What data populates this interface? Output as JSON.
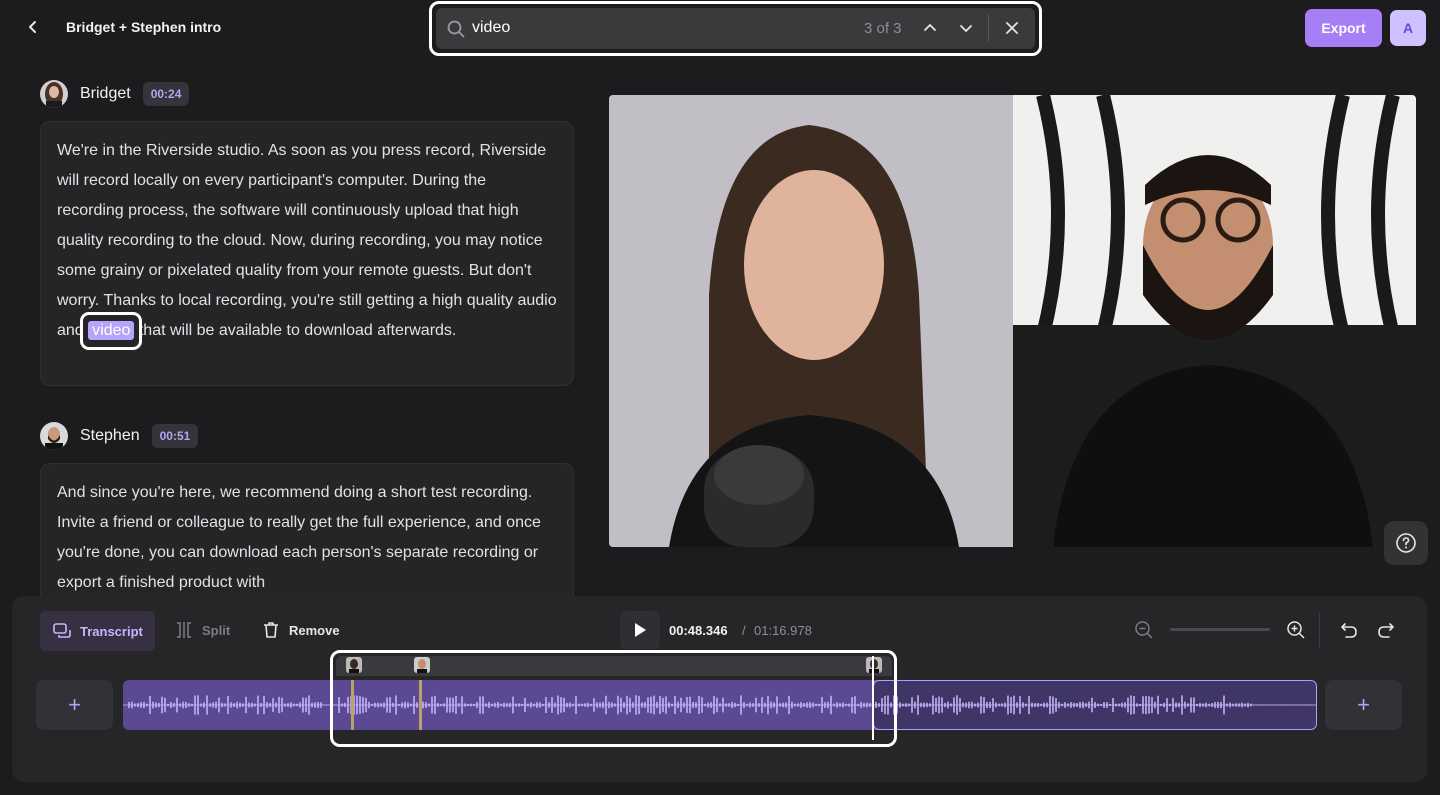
{
  "header": {
    "back_icon": "chevron-left-icon",
    "project_title": "Bridget + Stephen intro",
    "search": {
      "value": "video",
      "match_count": "3 of 3"
    },
    "export_label": "Export",
    "avatar_letter": "A"
  },
  "transcript": [
    {
      "speaker": "Bridget",
      "timestamp": "00:24",
      "text_before": "We're in the Riverside studio. As soon as you press record, Riverside will record locally on every participant's computer. During the recording process, the software will continuously upload that high quality recording to the cloud. Now, during recording, you may notice some grainy or pixelated quality from your remote guests. But don't worry. Thanks to local recording, you're still getting a high quality audio and",
      "highlight": "video",
      "text_after": "that will be available to download afterwards."
    },
    {
      "speaker": "Stephen",
      "timestamp": "00:51",
      "text": "And since you're here, we recommend doing a short test recording. Invite a friend or colleague to really get the full experience, and once you're done, you can download each person's separate recording or export a finished product with"
    }
  ],
  "toolbar": {
    "transcript_label": "Transcript",
    "split_label": "Split",
    "remove_label": "Remove"
  },
  "playback": {
    "current_time": "00:48.346",
    "separator": "/",
    "total_time": "01:16.978"
  },
  "timeline": {
    "add_label": "+"
  },
  "colors": {
    "accent": "#a67ef5",
    "highlight": "#b7a3f7",
    "track": "#5b4994"
  }
}
